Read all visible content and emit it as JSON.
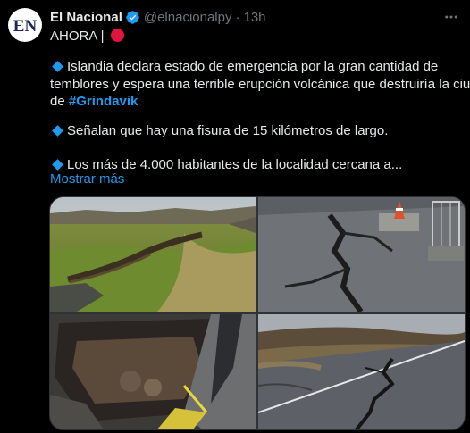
{
  "tweet": {
    "display_name": "El Nacional",
    "handle": "@elnacionalpy",
    "separator": "·",
    "time": "13h",
    "avatar_text": "EN",
    "lines": {
      "l1": "AHORA |",
      "l2": "Islandia declara estado de emergencia por la gran cantidad de",
      "l3a": "temblores y espera una terrible erupción volcánica que destruiría la ciudad",
      "l3b_prefix": "de ",
      "l3b_hashtag": "#Grindavik",
      "l4": "Señalan que hay una fisura de 15 kilómetros de largo.",
      "l5": "Los más de 4.000 habitantes de la localidad cercana a..."
    },
    "show_more": "Mostrar más"
  },
  "colors": {
    "accent": "#1d9bf0",
    "background": "#000000",
    "text": "#e7e9ea",
    "muted": "#71767b",
    "alert_red": "#e0143c"
  },
  "icons": {
    "verified": "verified-badge-icon",
    "more": "more-options-icon",
    "bullet": "blue-diamond-icon",
    "alert": "red-circle-icon"
  }
}
